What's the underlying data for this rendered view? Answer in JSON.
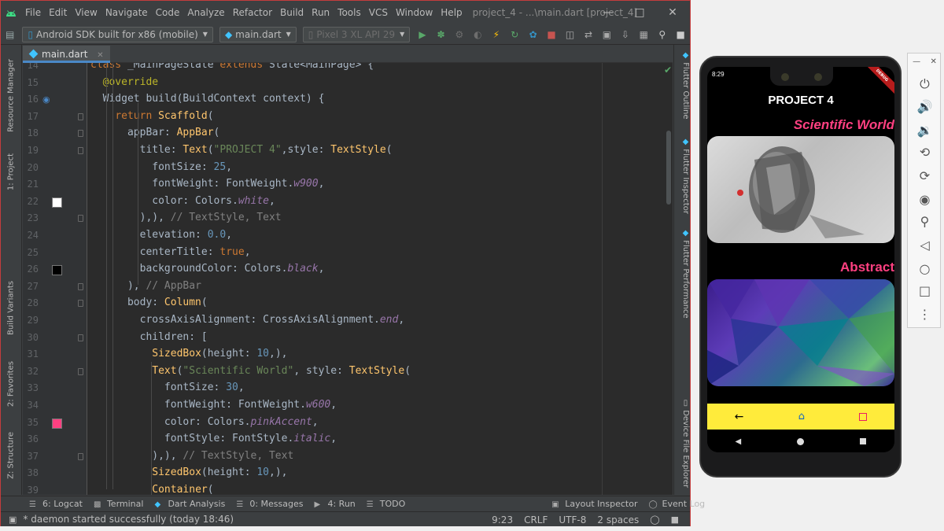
{
  "menubar": {
    "items": [
      "File",
      "Edit",
      "View",
      "Navigate",
      "Code",
      "Analyze",
      "Refactor",
      "Build",
      "Run",
      "Tools",
      "VCS",
      "Window",
      "Help"
    ],
    "title": "project_4 - ...\\main.dart [project_4]"
  },
  "toolbar": {
    "device_selector": "Android SDK built for x86 (mobile)",
    "run_config": "main.dart",
    "avd": "Pixel 3 XL API 29"
  },
  "left_tools": [
    "Resource Manager",
    "1: Project",
    "Build Variants",
    "2: Favorites",
    "Z: Structure"
  ],
  "right_tools": [
    "Flutter Outline",
    "Flutter Inspector",
    "Flutter Performance",
    "Device File Explorer"
  ],
  "editor": {
    "tab": "main.dart",
    "lines": [
      {
        "n": "14",
        "t": "class _MainPageState extends State<MainPage> {"
      },
      {
        "n": "15",
        "t": "  @override"
      },
      {
        "n": "16",
        "t": "  Widget build(BuildContext context) {"
      },
      {
        "n": "17",
        "t": "    return Scaffold("
      },
      {
        "n": "18",
        "t": "      appBar: AppBar("
      },
      {
        "n": "19",
        "t": "        title: Text(\"PROJECT 4\",style: TextStyle("
      },
      {
        "n": "20",
        "t": "          fontSize: 25,"
      },
      {
        "n": "21",
        "t": "          fontWeight: FontWeight.w900,"
      },
      {
        "n": "22",
        "t": "          color: Colors.white,"
      },
      {
        "n": "23",
        "t": "        ),), // TextStyle, Text"
      },
      {
        "n": "24",
        "t": "        elevation: 0.0,"
      },
      {
        "n": "25",
        "t": "        centerTitle: true,"
      },
      {
        "n": "26",
        "t": "        backgroundColor: Colors.black,"
      },
      {
        "n": "27",
        "t": "      ), // AppBar"
      },
      {
        "n": "28",
        "t": "      body: Column("
      },
      {
        "n": "29",
        "t": "        crossAxisAlignment: CrossAxisAlignment.end,"
      },
      {
        "n": "30",
        "t": "        children: ["
      },
      {
        "n": "31",
        "t": "          SizedBox(height: 10,),"
      },
      {
        "n": "32",
        "t": "          Text(\"Scientific World\", style: TextStyle("
      },
      {
        "n": "33",
        "t": "            fontSize: 30,"
      },
      {
        "n": "34",
        "t": "            fontWeight: FontWeight.w600,"
      },
      {
        "n": "35",
        "t": "            color: Colors.pinkAccent,"
      },
      {
        "n": "36",
        "t": "            fontStyle: FontStyle.italic,"
      },
      {
        "n": "37",
        "t": "          ),), // TextStyle, Text"
      },
      {
        "n": "38",
        "t": "          SizedBox(height: 10,),"
      },
      {
        "n": "39",
        "t": "          Container("
      }
    ]
  },
  "colors": {
    "white_swatch": "#ffffff",
    "black_swatch": "#000000",
    "pink_swatch": "#ff4081",
    "keyword": "#cc7832",
    "class": "#ffc66d",
    "string": "#6a8759",
    "number": "#6897bb",
    "field": "#9876aa",
    "comment": "#808080",
    "annotation": "#bbb529"
  },
  "bottom_tools": [
    "6: Logcat",
    "Terminal",
    "Dart Analysis",
    "0: Messages",
    "4: Run",
    "TODO",
    "Layout Inspector",
    "Event Log"
  ],
  "status": {
    "message": "* daemon started successfully (today 18:46)",
    "position": "9:23",
    "line_sep": "CRLF",
    "encoding": "UTF-8",
    "indent": "2 spaces"
  },
  "phone": {
    "time": "8:29",
    "debug": "DEBUG",
    "app_title": "PROJECT 4",
    "heading1": "Scientific World",
    "heading2": "Abstract",
    "nav_icons": [
      "arrow-back-icon",
      "home-icon",
      "square-icon"
    ]
  }
}
